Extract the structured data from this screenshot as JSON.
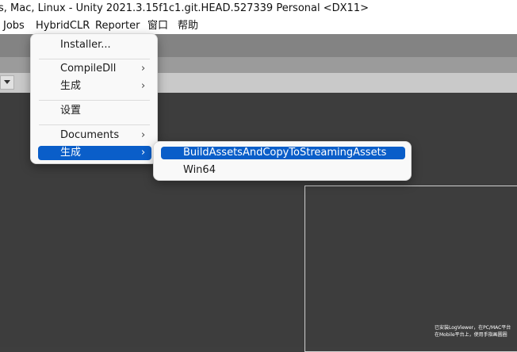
{
  "window": {
    "title": "s, Mac, Linux - Unity 2021.3.15f1c1.git.HEAD.527339 Personal <DX11>"
  },
  "menubar": {
    "items": [
      {
        "label": "Jobs"
      },
      {
        "label": "HybridCLR"
      },
      {
        "label": "Reporter"
      },
      {
        "label": "窗口"
      },
      {
        "label": "帮助"
      }
    ]
  },
  "main_menu": {
    "items": [
      {
        "label": "Installer...",
        "has_submenu": false
      },
      {
        "label": "CompileDll",
        "has_submenu": true
      },
      {
        "label": "生成",
        "has_submenu": true
      },
      {
        "label": "设置",
        "has_submenu": false
      },
      {
        "label": "Documents",
        "has_submenu": true
      },
      {
        "label": "生成",
        "has_submenu": true,
        "highlighted": true
      }
    ],
    "arrow_glyph": "›"
  },
  "sub_menu": {
    "items": [
      {
        "label": "BuildAssetsAndCopyToStreamingAssets",
        "highlighted": true
      },
      {
        "label": "Win64",
        "highlighted": false
      }
    ]
  },
  "game_overlay": {
    "line1": "已安装LogViewer，在PC/MAC平台",
    "line2": "在Mobile平台上，使用手指画圆圈"
  },
  "colors": {
    "highlight": "#0a5ec9",
    "scene_bg": "#3d3d3d"
  }
}
